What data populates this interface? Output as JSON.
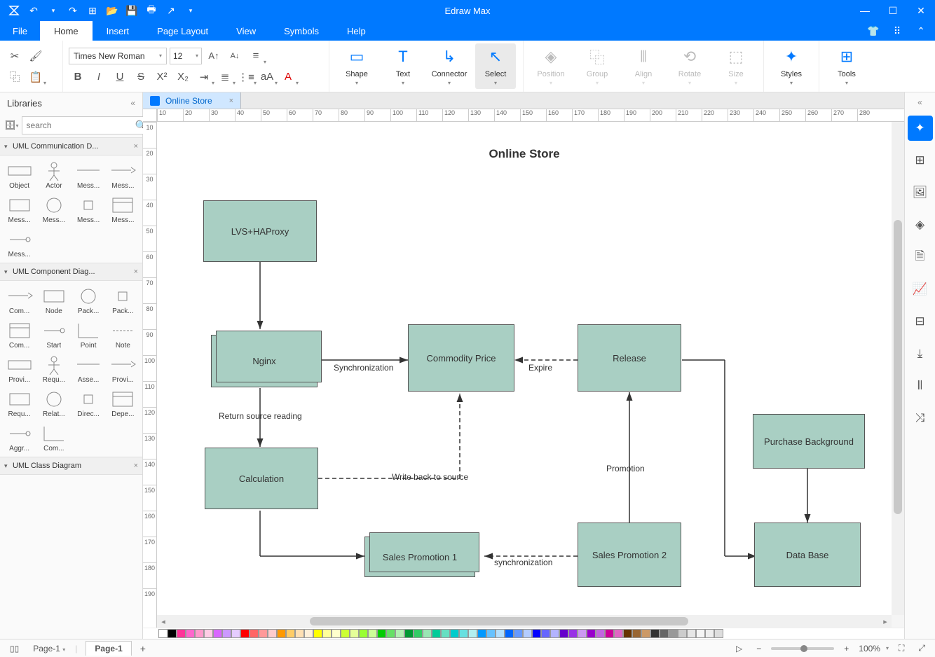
{
  "app": {
    "title": "Edraw Max"
  },
  "menu": {
    "tabs": [
      "File",
      "Home",
      "Insert",
      "Page Layout",
      "View",
      "Symbols",
      "Help"
    ],
    "active": "Home"
  },
  "ribbon": {
    "font_name": "Times New Roman",
    "font_size": "12",
    "tools": {
      "shape": "Shape",
      "text": "Text",
      "connector": "Connector",
      "select": "Select",
      "position": "Position",
      "group": "Group",
      "align": "Align",
      "rotate": "Rotate",
      "size": "Size",
      "styles": "Styles",
      "tools_btn": "Tools"
    }
  },
  "libraries": {
    "title": "Libraries",
    "search_placeholder": "search",
    "sections": {
      "comm": "UML Communication D...",
      "comp": "UML Component Diag...",
      "class": "UML Class Diagram"
    },
    "comm_shapes": [
      "Object",
      "Actor",
      "Mess...",
      "Mess...",
      "Mess...",
      "Mess...",
      "Mess...",
      "Mess...",
      "Mess..."
    ],
    "comp_shapes": [
      "Com...",
      "Node",
      "Pack...",
      "Pack...",
      "Com...",
      "Start",
      "Point",
      "Note",
      "Provi...",
      "Requ...",
      "Asse...",
      "Provi...",
      "Requ...",
      "Relat...",
      "Direc...",
      "Depe...",
      "Aggr...",
      "Com..."
    ]
  },
  "document": {
    "tab_name": "Online Store",
    "title": "Online Store",
    "nodes": {
      "lvs": "LVS+HAProxy",
      "nginx": "Nginx",
      "price": "Commodity Price",
      "release": "Release",
      "calc": "Calculation",
      "promo1": "Sales Promotion 1",
      "promo2": "Sales Promotion 2",
      "purchase": "Purchase Background",
      "db": "Data Base"
    },
    "edges": {
      "sync": "Synchronization",
      "expire": "Expire",
      "ret": "Return source reading",
      "write": "Write back to source",
      "promo": "Promotion",
      "sync2": "synchronization"
    }
  },
  "status": {
    "page_sel": "Page-1",
    "page_tab": "Page-1",
    "zoom": "100%"
  },
  "ruler_h": [
    "10",
    "20",
    "30",
    "40",
    "50",
    "60",
    "70",
    "80",
    "90",
    "100",
    "110",
    "120",
    "130",
    "140",
    "150",
    "160",
    "170",
    "180",
    "190",
    "200",
    "210",
    "220",
    "230",
    "240",
    "250",
    "260",
    "270",
    "280"
  ],
  "ruler_v": [
    "10",
    "20",
    "30",
    "40",
    "50",
    "60",
    "70",
    "80",
    "90",
    "100",
    "110",
    "120",
    "130",
    "140",
    "150",
    "160",
    "170",
    "180",
    "190"
  ],
  "colors": [
    "#ffffff",
    "#000000",
    "#ff3399",
    "#ff66cc",
    "#ff99cc",
    "#ffcce5",
    "#d966ff",
    "#cc99ff",
    "#e5ccff",
    "#ff0000",
    "#ff6666",
    "#ff9999",
    "#ffcccc",
    "#ff9900",
    "#ffcc66",
    "#ffe0b3",
    "#fff0d9",
    "#ffff00",
    "#ffff99",
    "#ffffcc",
    "#ccff33",
    "#e5ff99",
    "#99ff33",
    "#ccff99",
    "#00cc00",
    "#66e066",
    "#b3f0b3",
    "#009933",
    "#33cc66",
    "#99e6b3",
    "#00cc99",
    "#66e0c2",
    "#00cccc",
    "#66e0e0",
    "#b3f0f0",
    "#0099ff",
    "#66c2ff",
    "#b3e0ff",
    "#0066ff",
    "#6699ff",
    "#b3ccff",
    "#0000ff",
    "#6666ff",
    "#b3b3ff",
    "#6600cc",
    "#9933e6",
    "#cc99f2",
    "#9900cc",
    "#c266e0",
    "#cc0099",
    "#e066c2",
    "#663300",
    "#996633",
    "#cc9966",
    "#333333",
    "#666666",
    "#999999",
    "#cccccc",
    "#e6e6e6",
    "#f5f5f5",
    "#eeeeee",
    "#dddddd"
  ]
}
